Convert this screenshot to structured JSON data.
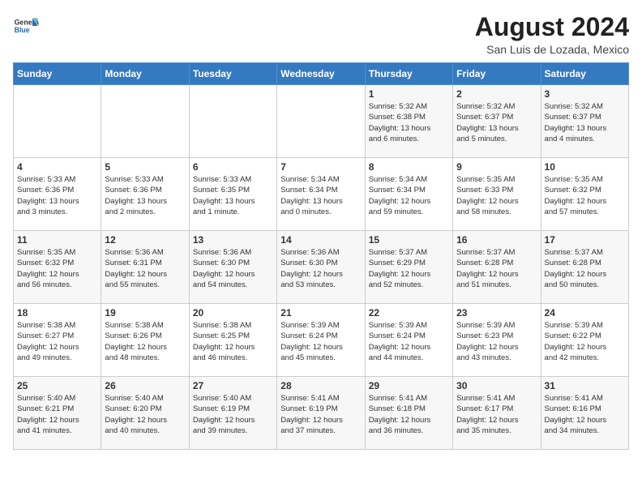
{
  "logo": {
    "general": "General",
    "blue": "Blue"
  },
  "title": {
    "month_year": "August 2024",
    "location": "San Luis de Lozada, Mexico"
  },
  "days_of_week": [
    "Sunday",
    "Monday",
    "Tuesday",
    "Wednesday",
    "Thursday",
    "Friday",
    "Saturday"
  ],
  "weeks": [
    [
      {
        "day": "",
        "content": ""
      },
      {
        "day": "",
        "content": ""
      },
      {
        "day": "",
        "content": ""
      },
      {
        "day": "",
        "content": ""
      },
      {
        "day": "1",
        "content": "Sunrise: 5:32 AM\nSunset: 6:38 PM\nDaylight: 13 hours\nand 6 minutes."
      },
      {
        "day": "2",
        "content": "Sunrise: 5:32 AM\nSunset: 6:37 PM\nDaylight: 13 hours\nand 5 minutes."
      },
      {
        "day": "3",
        "content": "Sunrise: 5:32 AM\nSunset: 6:37 PM\nDaylight: 13 hours\nand 4 minutes."
      }
    ],
    [
      {
        "day": "4",
        "content": "Sunrise: 5:33 AM\nSunset: 6:36 PM\nDaylight: 13 hours\nand 3 minutes."
      },
      {
        "day": "5",
        "content": "Sunrise: 5:33 AM\nSunset: 6:36 PM\nDaylight: 13 hours\nand 2 minutes."
      },
      {
        "day": "6",
        "content": "Sunrise: 5:33 AM\nSunset: 6:35 PM\nDaylight: 13 hours\nand 1 minute."
      },
      {
        "day": "7",
        "content": "Sunrise: 5:34 AM\nSunset: 6:34 PM\nDaylight: 13 hours\nand 0 minutes."
      },
      {
        "day": "8",
        "content": "Sunrise: 5:34 AM\nSunset: 6:34 PM\nDaylight: 12 hours\nand 59 minutes."
      },
      {
        "day": "9",
        "content": "Sunrise: 5:35 AM\nSunset: 6:33 PM\nDaylight: 12 hours\nand 58 minutes."
      },
      {
        "day": "10",
        "content": "Sunrise: 5:35 AM\nSunset: 6:32 PM\nDaylight: 12 hours\nand 57 minutes."
      }
    ],
    [
      {
        "day": "11",
        "content": "Sunrise: 5:35 AM\nSunset: 6:32 PM\nDaylight: 12 hours\nand 56 minutes."
      },
      {
        "day": "12",
        "content": "Sunrise: 5:36 AM\nSunset: 6:31 PM\nDaylight: 12 hours\nand 55 minutes."
      },
      {
        "day": "13",
        "content": "Sunrise: 5:36 AM\nSunset: 6:30 PM\nDaylight: 12 hours\nand 54 minutes."
      },
      {
        "day": "14",
        "content": "Sunrise: 5:36 AM\nSunset: 6:30 PM\nDaylight: 12 hours\nand 53 minutes."
      },
      {
        "day": "15",
        "content": "Sunrise: 5:37 AM\nSunset: 6:29 PM\nDaylight: 12 hours\nand 52 minutes."
      },
      {
        "day": "16",
        "content": "Sunrise: 5:37 AM\nSunset: 6:28 PM\nDaylight: 12 hours\nand 51 minutes."
      },
      {
        "day": "17",
        "content": "Sunrise: 5:37 AM\nSunset: 6:28 PM\nDaylight: 12 hours\nand 50 minutes."
      }
    ],
    [
      {
        "day": "18",
        "content": "Sunrise: 5:38 AM\nSunset: 6:27 PM\nDaylight: 12 hours\nand 49 minutes."
      },
      {
        "day": "19",
        "content": "Sunrise: 5:38 AM\nSunset: 6:26 PM\nDaylight: 12 hours\nand 48 minutes."
      },
      {
        "day": "20",
        "content": "Sunrise: 5:38 AM\nSunset: 6:25 PM\nDaylight: 12 hours\nand 46 minutes."
      },
      {
        "day": "21",
        "content": "Sunrise: 5:39 AM\nSunset: 6:24 PM\nDaylight: 12 hours\nand 45 minutes."
      },
      {
        "day": "22",
        "content": "Sunrise: 5:39 AM\nSunset: 6:24 PM\nDaylight: 12 hours\nand 44 minutes."
      },
      {
        "day": "23",
        "content": "Sunrise: 5:39 AM\nSunset: 6:23 PM\nDaylight: 12 hours\nand 43 minutes."
      },
      {
        "day": "24",
        "content": "Sunrise: 5:39 AM\nSunset: 6:22 PM\nDaylight: 12 hours\nand 42 minutes."
      }
    ],
    [
      {
        "day": "25",
        "content": "Sunrise: 5:40 AM\nSunset: 6:21 PM\nDaylight: 12 hours\nand 41 minutes."
      },
      {
        "day": "26",
        "content": "Sunrise: 5:40 AM\nSunset: 6:20 PM\nDaylight: 12 hours\nand 40 minutes."
      },
      {
        "day": "27",
        "content": "Sunrise: 5:40 AM\nSunset: 6:19 PM\nDaylight: 12 hours\nand 39 minutes."
      },
      {
        "day": "28",
        "content": "Sunrise: 5:41 AM\nSunset: 6:19 PM\nDaylight: 12 hours\nand 37 minutes."
      },
      {
        "day": "29",
        "content": "Sunrise: 5:41 AM\nSunset: 6:18 PM\nDaylight: 12 hours\nand 36 minutes."
      },
      {
        "day": "30",
        "content": "Sunrise: 5:41 AM\nSunset: 6:17 PM\nDaylight: 12 hours\nand 35 minutes."
      },
      {
        "day": "31",
        "content": "Sunrise: 5:41 AM\nSunset: 6:16 PM\nDaylight: 12 hours\nand 34 minutes."
      }
    ]
  ]
}
